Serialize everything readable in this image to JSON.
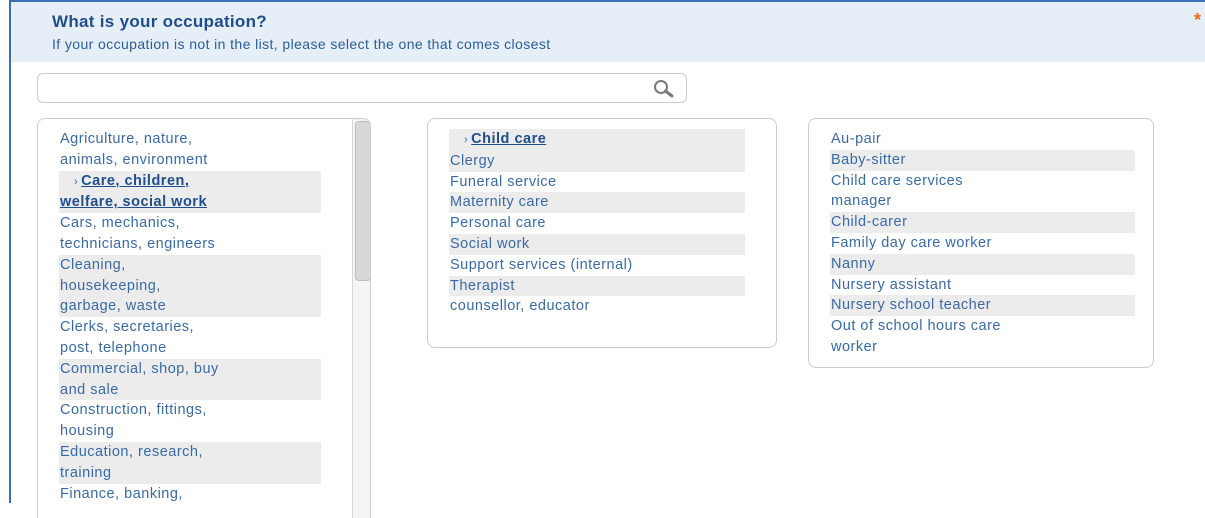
{
  "question": {
    "title": "What is your occupation?",
    "subtitle": "If your occupation is not in the list, please select the one that comes closest",
    "required_marker": "*"
  },
  "search": {
    "value": "",
    "placeholder": "",
    "icon": "search-icon"
  },
  "categories": {
    "items": [
      {
        "label": "Agriculture, nature,",
        "alt": false
      },
      {
        "label": "animals, environment",
        "alt": false
      },
      {
        "label": "Care, children,",
        "alt": true,
        "selected": true
      },
      {
        "label": "welfare, social work",
        "alt": true,
        "selected": true
      },
      {
        "label": "Cars, mechanics,",
        "alt": false
      },
      {
        "label": "technicians, engineers",
        "alt": false
      },
      {
        "label": "Cleaning,",
        "alt": true
      },
      {
        "label": "housekeeping,",
        "alt": true
      },
      {
        "label": "garbage, waste",
        "alt": true
      },
      {
        "label": "Clerks, secretaries,",
        "alt": false
      },
      {
        "label": "post, telephone",
        "alt": false
      },
      {
        "label": "Commercial, shop, buy",
        "alt": true
      },
      {
        "label": "and sale",
        "alt": true
      },
      {
        "label": "Construction, fittings,",
        "alt": false
      },
      {
        "label": "housing",
        "alt": false
      },
      {
        "label": "Education, research,",
        "alt": true
      },
      {
        "label": "training",
        "alt": true
      },
      {
        "label": "Finance, banking,",
        "alt": false
      }
    ]
  },
  "subcategories": {
    "items": [
      {
        "label": "Child care",
        "selected": true
      },
      {
        "label": "Clergy",
        "alt": true
      },
      {
        "label": "Funeral service",
        "alt": false
      },
      {
        "label": "Maternity care",
        "alt": true
      },
      {
        "label": "Personal care",
        "alt": false
      },
      {
        "label": "Social work",
        "alt": true
      },
      {
        "label": "Support services (internal)",
        "alt": false
      },
      {
        "label": "Therapist",
        "alt": true
      },
      {
        "label": "counsellor, educator",
        "alt": false
      }
    ]
  },
  "occupations": {
    "items": [
      {
        "label": "Au-pair",
        "alt": false
      },
      {
        "label": "Baby-sitter",
        "alt": true
      },
      {
        "label": "Child care services",
        "alt": false
      },
      {
        "label": "manager",
        "alt": false
      },
      {
        "label": "Child-carer",
        "alt": true
      },
      {
        "label": "Family day care worker",
        "alt": false
      },
      {
        "label": "Nanny",
        "alt": true
      },
      {
        "label": "Nursery assistant",
        "alt": false
      },
      {
        "label": "Nursery school teacher",
        "alt": true
      },
      {
        "label": "Out of school hours care",
        "alt": false
      },
      {
        "label": "worker",
        "alt": false
      }
    ]
  },
  "colors": {
    "accent": "#1f4e8a",
    "link": "#3a6aa3",
    "header_bg": "#e6eef7",
    "required": "#f26a1b",
    "alt_row": "#ececec"
  }
}
